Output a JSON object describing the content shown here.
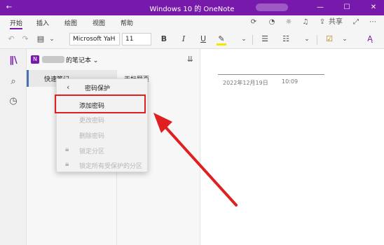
{
  "window": {
    "title": "Windows 10 的 OneNote"
  },
  "menu": {
    "tabs": [
      "开始",
      "插入",
      "绘图",
      "视图",
      "帮助"
    ],
    "share_label": "共享"
  },
  "ribbon": {
    "font_name": "Microsoft YaH",
    "font_size": "11",
    "bold": "B",
    "italic": "I",
    "underline": "U"
  },
  "notebook": {
    "name": "的笔记本",
    "sections": [
      "快速笔记"
    ],
    "pages": [
      "无标题页"
    ]
  },
  "page": {
    "date": "2022年12月19日",
    "time": "10:09"
  },
  "context_menu": {
    "title": "密码保护",
    "items": [
      {
        "label": "添加密码",
        "enabled": true
      },
      {
        "label": "更改密码",
        "enabled": false
      },
      {
        "label": "删除密码",
        "enabled": false
      },
      {
        "label": "锁定分区",
        "enabled": false
      },
      {
        "label": "锁定所有受保护的分区",
        "enabled": false
      }
    ]
  },
  "colors": {
    "accent": "#7719aa",
    "annotation": "#e02020"
  }
}
